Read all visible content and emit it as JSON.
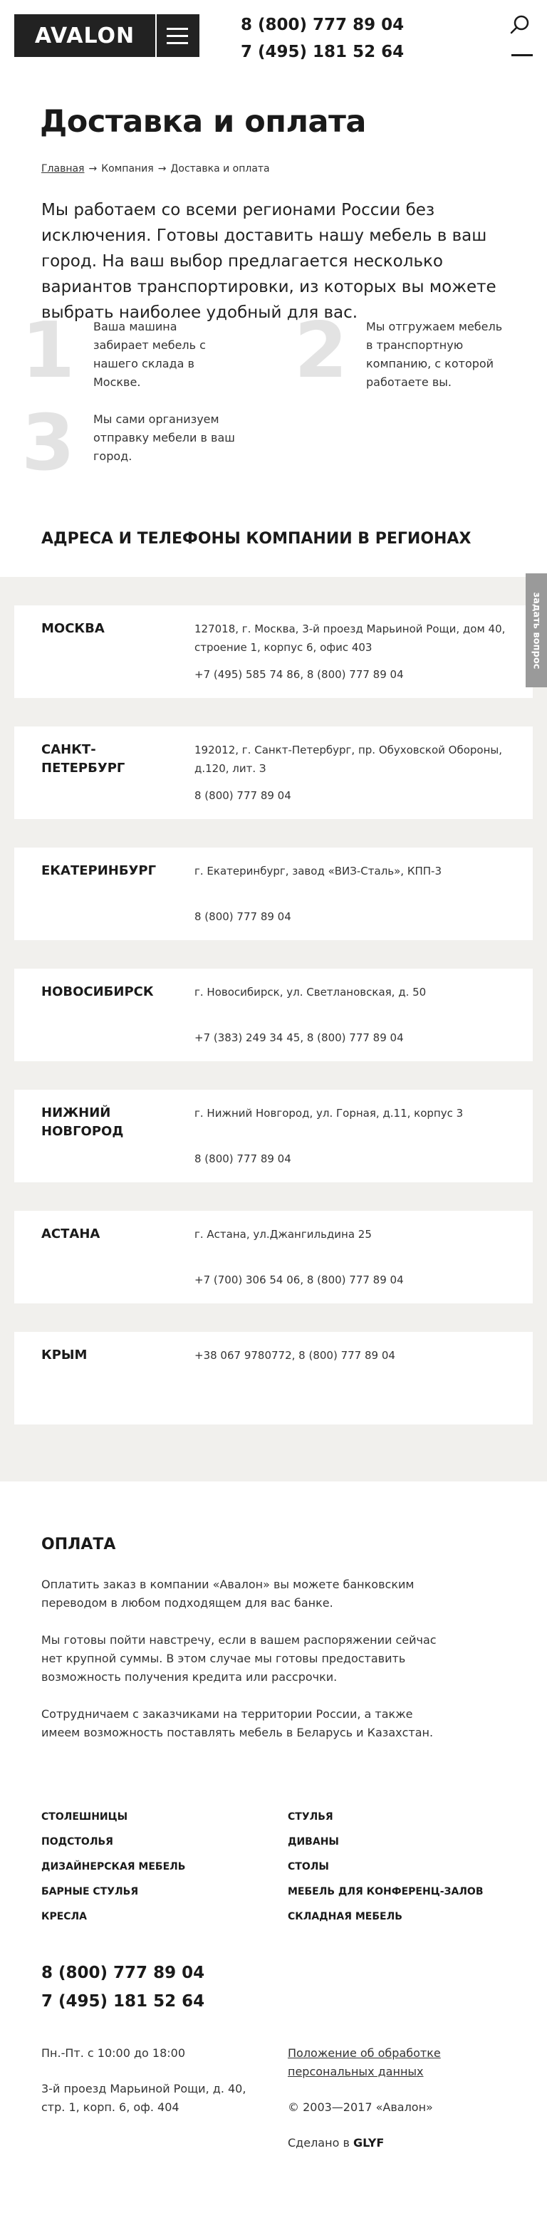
{
  "header": {
    "logo": "AVALON",
    "phone1": "8 (800) 777 89 04",
    "phone2": "7 (495) 181 52 64"
  },
  "page": {
    "title": "Доставка и оплата",
    "breadcrumb": [
      "Главная",
      "Компания",
      "Доставка и оплата"
    ],
    "intro": "Мы работаем со всеми регионами России без исключения. Готовы доставить нашу мебель в ваш город. На ваш выбор предлагается несколько вариантов транспортировки, из которых вы можете выбрать наиболее удобный для вас."
  },
  "steps": [
    {
      "num": "1",
      "text": "Ваша машина забирает мебель с нашего склада в Москве."
    },
    {
      "num": "2",
      "text": "Мы отгружаем мебель в транспортную компанию, с которой работаете вы."
    },
    {
      "num": "3",
      "text": "Мы сами организуем отправку мебели в ваш город."
    }
  ],
  "regions": {
    "title": "АДРЕСА И ТЕЛЕФОНЫ КОМПАНИИ В РЕГИОНАХ",
    "items": [
      {
        "city": "МОСКВА",
        "address": "127018, г. Москва, 3-й проезд Марьиной Рощи, дом 40, строение 1, корпус 6, офис 403",
        "phones": "+7 (495) 585 74 86, 8 (800) 777 89 04"
      },
      {
        "city": "САНКТ-ПЕТЕРБУРГ",
        "address": "192012, г. Санкт-Петербург, пр. Обуховской Обороны, д.120, лит. З",
        "phones": "8 (800) 777 89 04"
      },
      {
        "city": "ЕКАТЕРИНБУРГ",
        "address": "г. Екатеринбург, завод «ВИЗ-Сталь», КПП-3",
        "phones": "8 (800) 777 89 04"
      },
      {
        "city": "НОВОСИБИРСК",
        "address": "г. Новосибирск, ул. Светлановская, д. 50",
        "phones": "+7 (383) 249 34 45, 8 (800) 777 89 04"
      },
      {
        "city": "НИЖНИЙ НОВГОРОД",
        "address": "г. Нижний Новгород, ул. Горная, д.11, корпус 3",
        "phones": "8 (800) 777 89 04"
      },
      {
        "city": "АСТАНА",
        "address": "г. Астана, ул.Джангильдина 25",
        "phones": "+7 (700) 306 54 06, 8 (800) 777 89 04"
      },
      {
        "city": "КРЫМ",
        "address": "+38 067 9780772, 8 (800) 777 89 04",
        "phones": ""
      }
    ]
  },
  "ask_tab": "задать вопрос",
  "payment": {
    "title": "ОПЛАТА",
    "paragraphs": [
      "Оплатить заказ в компании «Авалон» вы можете банковским переводом в любом подходящем для вас банке.",
      "Мы готовы пойти навстречу, если в вашем распоряжении сейчас нет крупной суммы. В этом случае мы готовы предоставить возможность получения кредита или рассрочки.",
      "Сотрудничаем с заказчиками на территории России, а также имеем возможность поставлять мебель в Беларусь и Казахстан."
    ]
  },
  "footer": {
    "links_left": [
      "Столешницы",
      "Подстолья",
      "Дизайнерская мебель",
      "Барные стулья",
      "Кресла"
    ],
    "links_right": [
      "Стулья",
      "Диваны",
      "Столы",
      "Мебель для конференц-залов",
      "Складная мебель"
    ],
    "phone1": "8 (800) 777 89 04",
    "phone2": "7 (495) 181 52 64",
    "hours": "Пн.-Пт. с 10:00 до 18:00",
    "address": "3-й проезд Марьиной Рощи, д. 40, стр. 1, корп. 6, оф. 404",
    "policy": "Положение об обработке персональных данных",
    "copyright": "© 2003—2017 «Авалон»",
    "made_by_prefix": "Сделано в",
    "made_by": "GLYF"
  }
}
